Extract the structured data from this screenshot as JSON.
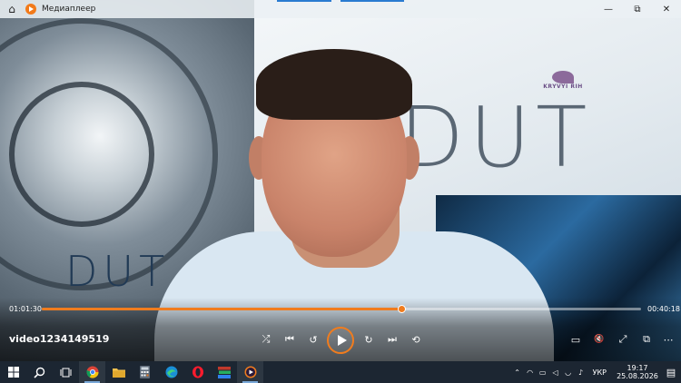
{
  "window": {
    "title": "Медиаплеер",
    "home_icon": "home-icon",
    "buttons": [
      "minimize-icon",
      "maximize-icon",
      "close-icon"
    ]
  },
  "video_content": {
    "background_logo_left": "DUT",
    "background_logo_right": "DUT",
    "watermark": "KRYVYI RIH"
  },
  "player": {
    "current_time": "01:01:30",
    "remaining_time": "00:40:18",
    "progress_fraction": 0.6,
    "media_title": "video1234149519",
    "accent_color": "#f07c1e",
    "controls": [
      {
        "name": "shuffle-button",
        "icon": "shuffle-icon",
        "glyph": "⤮"
      },
      {
        "name": "previous-button",
        "icon": "previous-icon",
        "glyph": "⏮"
      },
      {
        "name": "rewind-10-button",
        "icon": "rewind-10-icon",
        "glyph": "↺"
      },
      {
        "name": "play-button",
        "icon": "play-icon",
        "glyph": ""
      },
      {
        "name": "forward-30-button",
        "icon": "forward-30-icon",
        "glyph": "↻"
      },
      {
        "name": "next-button",
        "icon": "next-icon",
        "glyph": "⏭"
      },
      {
        "name": "repeat-off-button",
        "icon": "repeat-off-icon",
        "glyph": "⟲"
      }
    ],
    "right_controls": [
      {
        "name": "subtitles-button",
        "icon": "subtitles-icon",
        "glyph": "▭"
      },
      {
        "name": "mute-button",
        "icon": "volume-mute-icon",
        "glyph": "🔇"
      },
      {
        "name": "fullscreen-button",
        "icon": "fullscreen-icon",
        "glyph": "⤢"
      },
      {
        "name": "mini-view-button",
        "icon": "mini-view-icon",
        "glyph": "⧉"
      },
      {
        "name": "more-button",
        "icon": "more-icon",
        "glyph": "⋯"
      }
    ]
  },
  "taskbar": {
    "items": [
      {
        "name": "start-button",
        "icon": "windows-icon"
      },
      {
        "name": "search-button",
        "icon": "search-icon"
      },
      {
        "name": "task-view-button",
        "icon": "task-view-icon"
      },
      {
        "name": "chrome-button",
        "icon": "chrome-icon"
      },
      {
        "name": "file-explorer-button",
        "icon": "folder-icon"
      },
      {
        "name": "calculator-button",
        "icon": "calculator-icon"
      },
      {
        "name": "edge-button",
        "icon": "edge-icon"
      },
      {
        "name": "opera-button",
        "icon": "opera-icon"
      },
      {
        "name": "books-button",
        "icon": "books-icon"
      },
      {
        "name": "media-player-button",
        "icon": "media-player-icon"
      }
    ],
    "tray": {
      "language": "УКР",
      "time": "19:17",
      "date": "25.08.2026"
    }
  }
}
